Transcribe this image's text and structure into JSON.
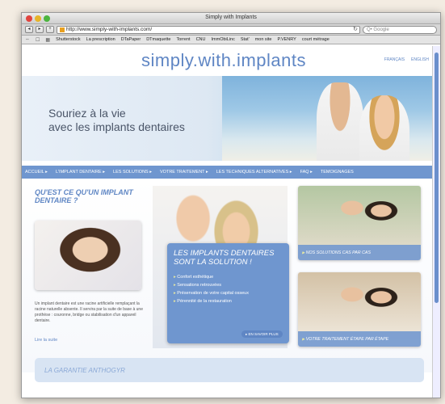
{
  "window": {
    "title": "Simply with Implants"
  },
  "toolbar": {
    "back": "◂",
    "forward": "▸",
    "add": "+",
    "url": "http://www.simply-with-implants.com/",
    "search_placeholder": "Q• Google"
  },
  "bookmarks": [
    "Shutterstock",
    "La prescription",
    "DTaPaper",
    "DTmaquette",
    "Torrent",
    "CNU",
    "ImmObiLinc",
    "Stat'",
    "mon site",
    "P.VENRY",
    "court métrage"
  ],
  "site": {
    "logo": "simply.with.implants",
    "lang": [
      "FRANÇAIS",
      "ENGLISH"
    ],
    "hero_line1": "Souriez à la vie",
    "hero_line2": "avec les implants dentaires",
    "nav": [
      "ACCUEIL ▸",
      "L'IMPLANT DENTAIRE ▸",
      "LES SOLUTIONS ▸",
      "VOTRE TRAITEMENT ▸",
      "LES TECHNIQUES ALTERNATIVES ▸",
      "FAQ ▸",
      "TEMOIGNAGES"
    ],
    "question_title": "Qu'est ce qu'un implant dentaire ?",
    "question_text": "Un implant dentaire est une racine artificielle remplaçant la racine naturelle absente. Il servira par la suite de base à une prothèse : couronne, bridge ou stabilisation d'un appareil dentaire.",
    "read_more": "Lire la suite",
    "solution_title": "Les implants dentaires sont la solution !",
    "solution_items": [
      "Confort esthétique",
      "Sensations retrouvées",
      "Préservation de votre capital osseux",
      "Pérennité de la restauration"
    ],
    "learn_more": "▸ EN SAVOIR PLUS",
    "card1_caption": "NOS SOLUTIONS CAS PAR CAS",
    "card2_caption": "VOTRE TRAITEMENT ÉTAPE PAR ÉTAPE",
    "guarantee": "LA GARANTIE ANTHOGYR"
  }
}
